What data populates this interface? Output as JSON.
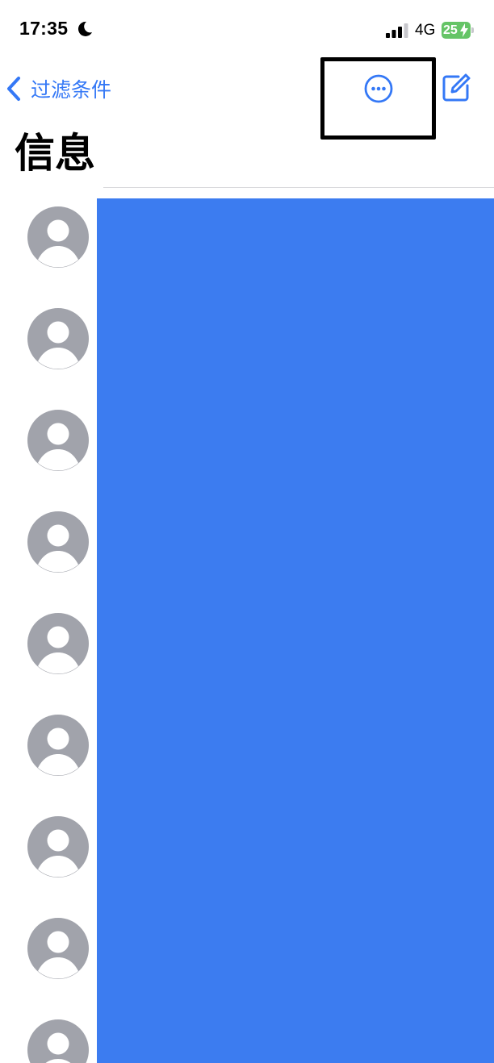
{
  "status_bar": {
    "time": "17:35",
    "network": "4G",
    "battery_level": "25",
    "icons": {
      "focus": "moon-icon",
      "signal": "signal-bars-icon",
      "battery": "battery-charging-icon"
    }
  },
  "nav": {
    "back_label": "过滤条件",
    "back_icon": "chevron-left-icon",
    "more_icon": "ellipsis-circle-icon",
    "compose_icon": "compose-icon"
  },
  "title": "信息",
  "colors": {
    "accent": "#3478f6",
    "redaction": "#3c7cf0",
    "avatar": "#a1a3ab",
    "battery": "#65c466",
    "highlight_border": "#000000"
  },
  "conversations": [
    {
      "avatar_icon": "person-avatar-icon"
    },
    {
      "avatar_icon": "person-avatar-icon"
    },
    {
      "avatar_icon": "person-avatar-icon"
    },
    {
      "avatar_icon": "person-avatar-icon"
    },
    {
      "avatar_icon": "person-avatar-icon"
    },
    {
      "avatar_icon": "person-avatar-icon"
    },
    {
      "avatar_icon": "person-avatar-icon"
    },
    {
      "avatar_icon": "person-avatar-icon"
    },
    {
      "avatar_icon": "person-avatar-icon"
    }
  ]
}
